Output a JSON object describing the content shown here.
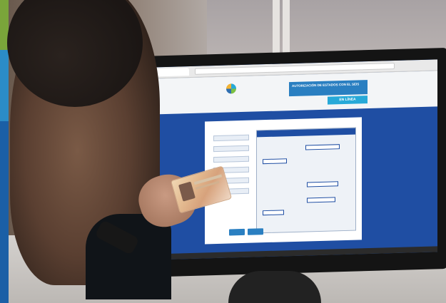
{
  "scene": {
    "description_colors": {
      "stripe_green": "#7aa53a",
      "stripe_blue": "#2b8cc7",
      "stripe_darkblue": "#1b5fa6",
      "screen_blue": "#1f4ea3",
      "banner_blue": "#2a7fc1",
      "accent_cyan": "#27a9d8"
    }
  },
  "website": {
    "banner_text": "AUTORIZACIÓN DE ESTADOS CON EL SEIS",
    "online_label": "EN LÍNEA"
  }
}
